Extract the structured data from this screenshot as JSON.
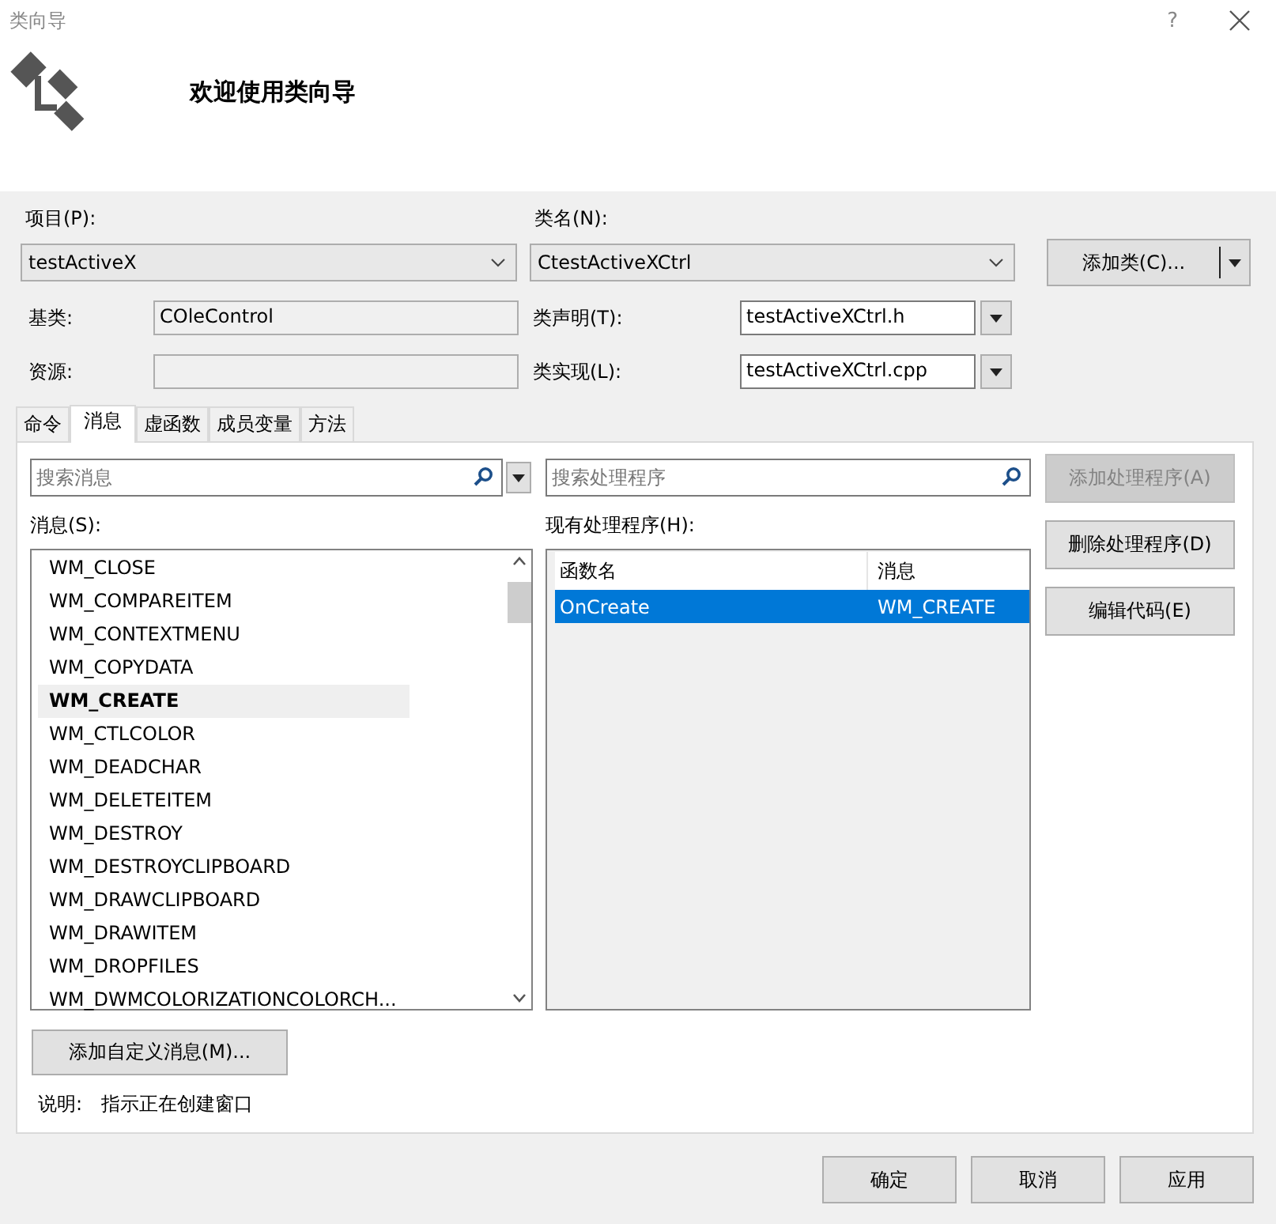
{
  "window": {
    "title": "类向导",
    "help": "?"
  },
  "header": {
    "heading": "欢迎使用类向导"
  },
  "form": {
    "project_label": "项目(P):",
    "project": "testActiveX",
    "classname_label": "类名(N):",
    "classname": "CtestActiveXCtrl",
    "add_class_button": "添加类(C)...",
    "base_label": "基类:",
    "base": "COleControl",
    "decl_label": "类声明(T):",
    "decl": "testActiveXCtrl.h",
    "resource_label": "资源:",
    "impl_label": "类实现(L):",
    "impl": "testActiveXCtrl.cpp"
  },
  "tabs": [
    {
      "label": "命令",
      "selected": false
    },
    {
      "label": "消息",
      "selected": true
    },
    {
      "label": "虚函数",
      "selected": false
    },
    {
      "label": "成员变量",
      "selected": false
    },
    {
      "label": "方法",
      "selected": false
    }
  ],
  "messages": {
    "search_placeholder": "搜索消息",
    "label": "消息(S):",
    "items": [
      {
        "text": "WM_CLOSE",
        "selected": false
      },
      {
        "text": "WM_COMPAREITEM",
        "selected": false
      },
      {
        "text": "WM_CONTEXTMENU",
        "selected": false
      },
      {
        "text": "WM_COPYDATA",
        "selected": false
      },
      {
        "text": "WM_CREATE",
        "selected": true
      },
      {
        "text": "WM_CTLCOLOR",
        "selected": false
      },
      {
        "text": "WM_DEADCHAR",
        "selected": false
      },
      {
        "text": "WM_DELETEITEM",
        "selected": false
      },
      {
        "text": "WM_DESTROY",
        "selected": false
      },
      {
        "text": "WM_DESTROYCLIPBOARD",
        "selected": false
      },
      {
        "text": "WM_DRAWCLIPBOARD",
        "selected": false
      },
      {
        "text": "WM_DRAWITEM",
        "selected": false
      },
      {
        "text": "WM_DROPFILES",
        "selected": false
      },
      {
        "text": "WM_DWMCOLORIZATIONCOLORCH...",
        "selected": false
      }
    ]
  },
  "handlers": {
    "search_placeholder": "搜索处理程序",
    "label": "现有处理程序(H):",
    "columns": [
      "函数名",
      "消息"
    ],
    "rows": [
      {
        "cells": [
          "OnCreate",
          "WM_CREATE"
        ],
        "selected": true
      }
    ]
  },
  "side_buttons": [
    {
      "label": "添加处理程序(A)",
      "disabled": true
    },
    {
      "label": "删除处理程序(D)",
      "disabled": false
    },
    {
      "label": "编辑代码(E)",
      "disabled": false
    }
  ],
  "custom_message_button": "添加自定义消息(M)...",
  "description": {
    "label": "说明:",
    "text": "指示正在创建窗口"
  },
  "footer_buttons": [
    {
      "label": "确定",
      "disabled": false
    },
    {
      "label": "取消",
      "disabled": false
    },
    {
      "label": "应用",
      "disabled": false
    }
  ]
}
